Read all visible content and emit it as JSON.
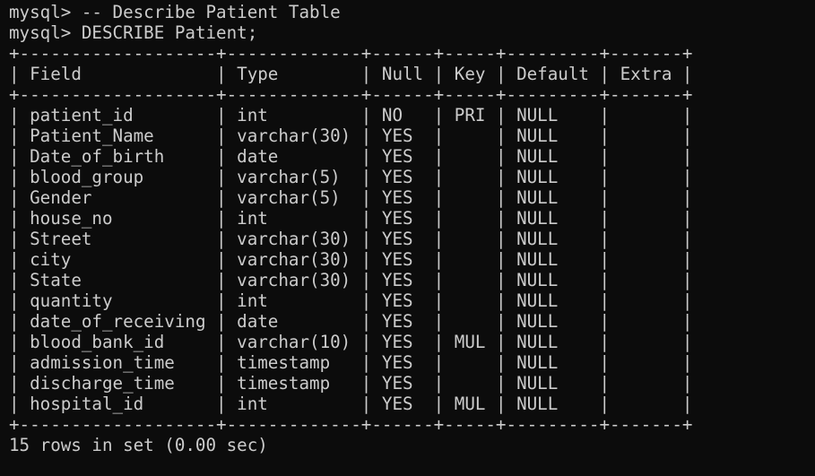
{
  "terminal": {
    "prompt": "mysql>",
    "commands": [
      "-- Describe Patient Table",
      "DESCRIBE Patient;"
    ],
    "colors": {
      "background": "#0c0c0c",
      "foreground": "#cccccc"
    }
  },
  "table": {
    "columns": [
      "Field",
      "Type",
      "Null",
      "Key",
      "Default",
      "Extra"
    ],
    "rows": [
      [
        "patient_id",
        "int",
        "NO",
        "PRI",
        "NULL",
        ""
      ],
      [
        "Patient_Name",
        "varchar(30)",
        "YES",
        "",
        "NULL",
        ""
      ],
      [
        "Date_of_birth",
        "date",
        "YES",
        "",
        "NULL",
        ""
      ],
      [
        "blood_group",
        "varchar(5)",
        "YES",
        "",
        "NULL",
        ""
      ],
      [
        "Gender",
        "varchar(5)",
        "YES",
        "",
        "NULL",
        ""
      ],
      [
        "house_no",
        "int",
        "YES",
        "",
        "NULL",
        ""
      ],
      [
        "Street",
        "varchar(30)",
        "YES",
        "",
        "NULL",
        ""
      ],
      [
        "city",
        "varchar(30)",
        "YES",
        "",
        "NULL",
        ""
      ],
      [
        "State",
        "varchar(30)",
        "YES",
        "",
        "NULL",
        ""
      ],
      [
        "quantity",
        "int",
        "YES",
        "",
        "NULL",
        ""
      ],
      [
        "date_of_receiving",
        "date",
        "YES",
        "",
        "NULL",
        ""
      ],
      [
        "blood_bank_id",
        "varchar(10)",
        "YES",
        "MUL",
        "NULL",
        ""
      ],
      [
        "admission_time",
        "timestamp",
        "YES",
        "",
        "NULL",
        ""
      ],
      [
        "discharge_time",
        "timestamp",
        "YES",
        "",
        "NULL",
        ""
      ],
      [
        "hospital_id",
        "int",
        "YES",
        "MUL",
        "NULL",
        ""
      ]
    ]
  },
  "result_summary": "15 rows in set (0.00 sec)"
}
